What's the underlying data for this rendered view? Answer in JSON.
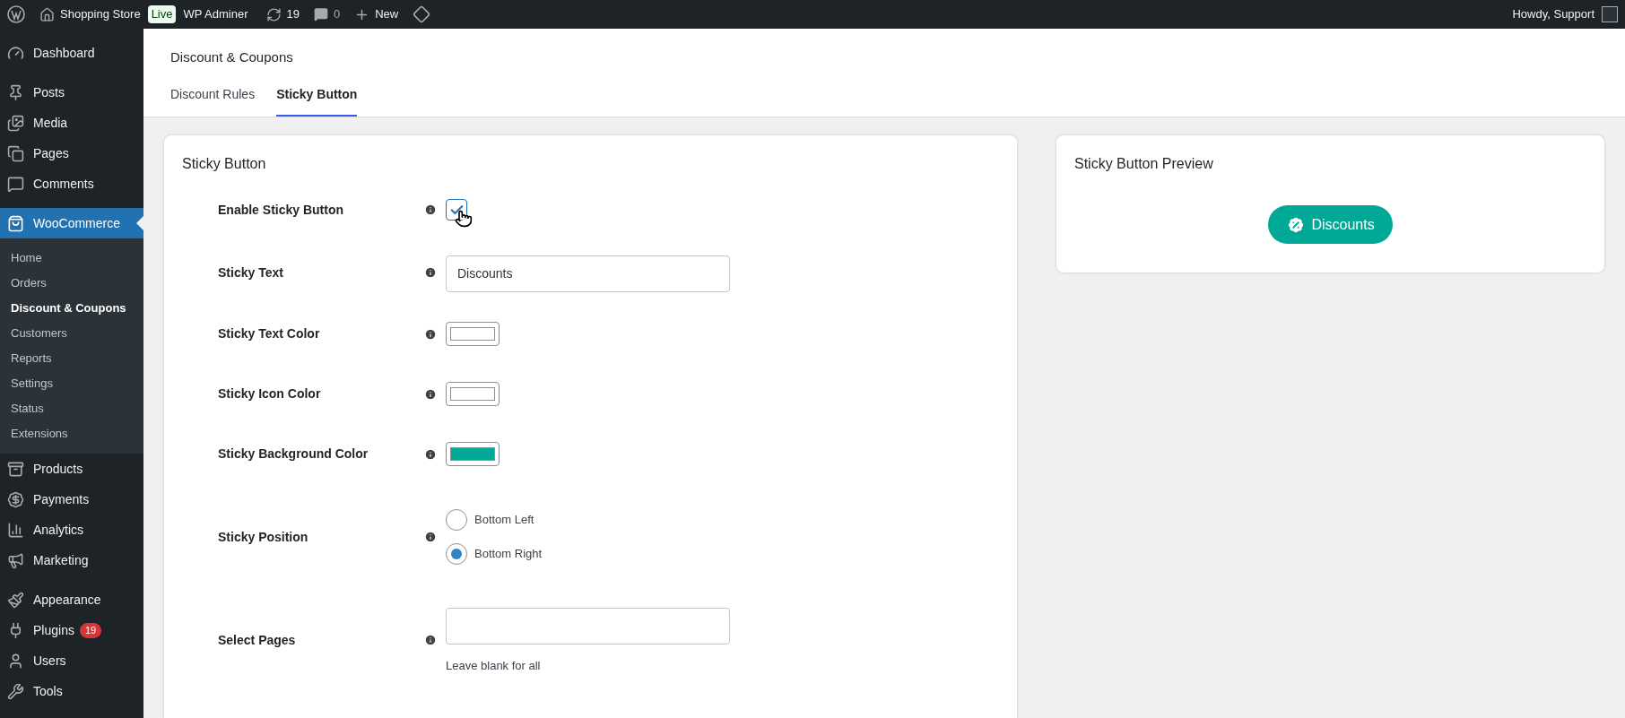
{
  "admin_bar": {
    "site_name": "Shopping Store",
    "live_badge": "Live",
    "plugin_link": "WP Adminer",
    "updates": "19",
    "comments": "0",
    "new_label": "New",
    "greeting": "Howdy, Support"
  },
  "sidebar": {
    "sections": [
      {
        "items": [
          {
            "label": "Dashboard",
            "selected": false
          }
        ]
      },
      {
        "items": [
          {
            "label": "Posts",
            "selected": false
          },
          {
            "label": "Media",
            "selected": false
          },
          {
            "label": "Pages",
            "selected": false
          },
          {
            "label": "Comments",
            "selected": false
          }
        ]
      },
      {
        "items": [
          {
            "label": "WooCommerce",
            "selected": true,
            "children": [
              {
                "label": "Home",
                "selected": false
              },
              {
                "label": "Orders",
                "selected": false
              },
              {
                "label": "Discount & Coupons",
                "selected": true
              },
              {
                "label": "Customers",
                "selected": false
              },
              {
                "label": "Reports",
                "selected": false
              },
              {
                "label": "Settings",
                "selected": false
              },
              {
                "label": "Status",
                "selected": false
              },
              {
                "label": "Extensions",
                "selected": false
              }
            ]
          },
          {
            "label": "Products",
            "selected": false
          },
          {
            "label": "Payments",
            "selected": false
          },
          {
            "label": "Analytics",
            "selected": false
          },
          {
            "label": "Marketing",
            "selected": false
          }
        ]
      },
      {
        "items": [
          {
            "label": "Appearance",
            "selected": false
          },
          {
            "label": "Plugins",
            "selected": false,
            "badge": "19"
          },
          {
            "label": "Users",
            "selected": false
          },
          {
            "label": "Tools",
            "selected": false
          }
        ]
      }
    ]
  },
  "page": {
    "title": "Discount & Coupons",
    "tabs": [
      {
        "label": "Discount Rules",
        "selected": false
      },
      {
        "label": "Sticky Button",
        "selected": true
      }
    ]
  },
  "settings_card": {
    "title": "Sticky Button",
    "fields": [
      {
        "kind": "checkbox",
        "label": "Enable Sticky Button",
        "checked": true
      },
      {
        "kind": "text",
        "label": "Sticky Text",
        "value": "Discounts"
      },
      {
        "kind": "color",
        "label": "Sticky Text Color",
        "color": "#ffffff"
      },
      {
        "kind": "color",
        "label": "Sticky Icon Color",
        "color": "#ffffff"
      },
      {
        "kind": "color",
        "label": "Sticky Background Color",
        "color": "#00a896"
      },
      {
        "kind": "radio",
        "label": "Sticky Position",
        "options": [
          {
            "label": "Bottom Left",
            "selected": false
          },
          {
            "label": "Bottom Right",
            "selected": true
          }
        ]
      },
      {
        "kind": "text",
        "label": "Select Pages",
        "hint": "Leave blank for all"
      }
    ]
  },
  "preview_card": {
    "title": "Sticky Button Preview",
    "button_label": "Discounts"
  }
}
